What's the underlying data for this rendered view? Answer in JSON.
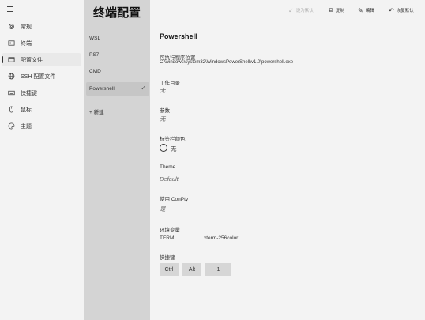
{
  "nav": {
    "items": [
      {
        "label": "常规",
        "icon": "gear-icon"
      },
      {
        "label": "终端",
        "icon": "terminal-icon"
      },
      {
        "label": "配置文件",
        "icon": "profile-icon"
      },
      {
        "label": "SSH 配置文件",
        "icon": "globe-icon"
      },
      {
        "label": "快捷键",
        "icon": "keyboard-icon"
      },
      {
        "label": "鼠标",
        "icon": "mouse-icon"
      },
      {
        "label": "主题",
        "icon": "palette-icon"
      }
    ]
  },
  "profiles": {
    "heading": "终端配置",
    "items": [
      "WSL",
      "PS7",
      "CMD",
      "Powershell"
    ],
    "new_label": "+ 新建"
  },
  "toolbar": {
    "set_default": "设为默认",
    "copy": "复制",
    "edit": "编辑",
    "restore_default": "恢复默认"
  },
  "detail": {
    "title": "Powershell",
    "exe_label": "可执行程序位置",
    "exe_value": "C:\\windows\\system32\\WindowsPowerShell\\v1.0\\powershell.exe",
    "workdir_label": "工作目录",
    "workdir_value": "无",
    "args_label": "参数",
    "args_value": "无",
    "tabcolor_label": "标签栏颜色",
    "tabcolor_value": "无",
    "theme_label": "Theme",
    "theme_value": "Default",
    "conpty_label": "使用 ConPty",
    "conpty_value": "是",
    "env_label": "环境变量",
    "env_key": "TERM",
    "env_value": "xterm-256color",
    "hotkey_label": "快捷键",
    "hotkeys": [
      "Ctrl",
      "Alt",
      "1"
    ]
  }
}
